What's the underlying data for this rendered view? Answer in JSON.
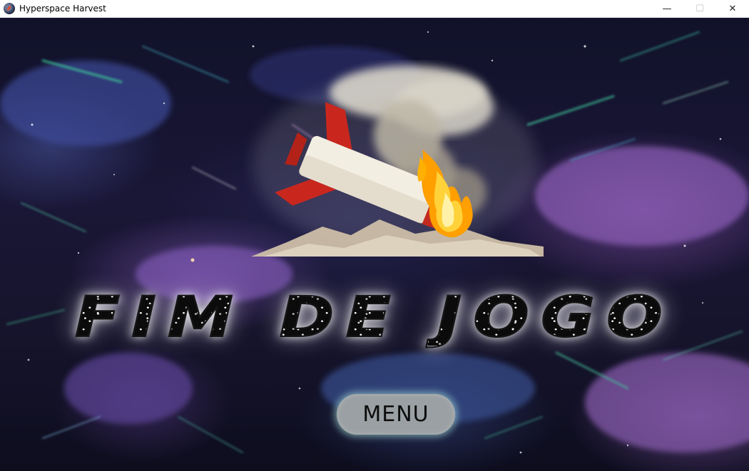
{
  "window": {
    "title": "Hyperspace Harvest",
    "minimize_glyph": "—",
    "maximize_glyph": "☐",
    "close_glyph": "✕"
  },
  "game": {
    "title_text": "FIM DE JOGO",
    "menu_button_label": "MENU"
  },
  "illustration": {
    "subject": "crashed-rocket-burning",
    "colors": {
      "rocket_body": "#f2ece0",
      "rocket_fins": "#c8281e",
      "fire": "#ffb300",
      "smoke": "#d8d4c8",
      "ground": "#c9b9a3"
    }
  },
  "colors": {
    "menu_button_bg": "#9aa0a3",
    "menu_button_glow": "#aae6dc",
    "title_glow": "#ffffff"
  }
}
